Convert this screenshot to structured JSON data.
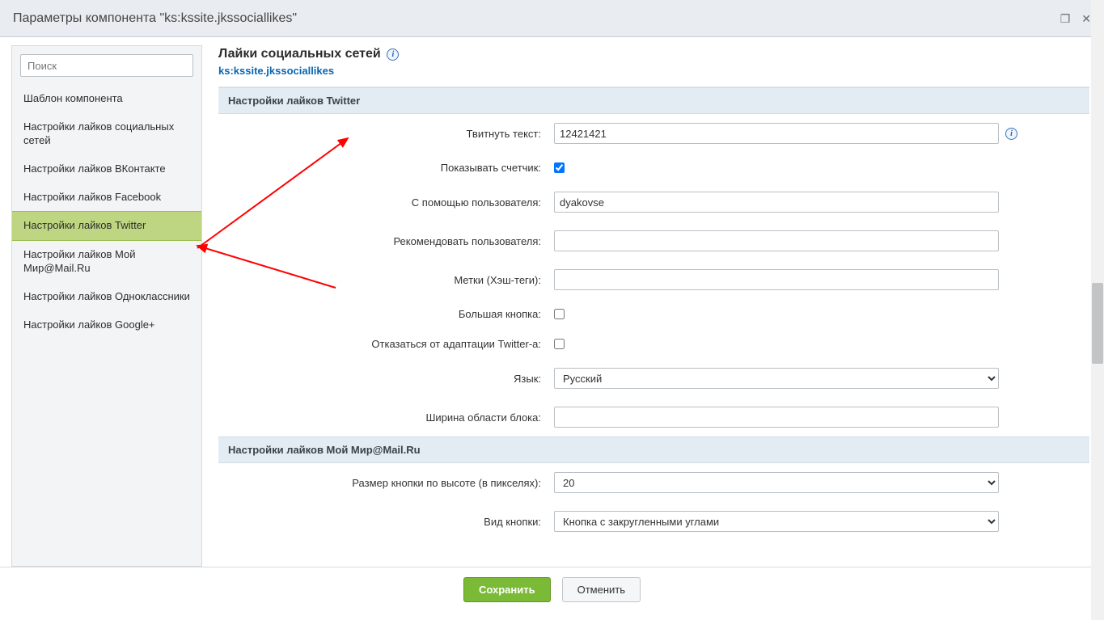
{
  "window": {
    "title": "Параметры компонента \"ks:kssite.jkssociallikes\""
  },
  "sidebar": {
    "search_placeholder": "Поиск",
    "items": [
      {
        "label": "Шаблон компонента"
      },
      {
        "label": "Настройки лайков социальных сетей"
      },
      {
        "label": "Настройки лайков ВКонтакте"
      },
      {
        "label": "Настройки лайков Facebook"
      },
      {
        "label": "Настройки лайков Twitter"
      },
      {
        "label": "Настройки лайков Мой Мир@Mail.Ru"
      },
      {
        "label": "Настройки лайков Одноклассники"
      },
      {
        "label": "Настройки лайков Google+"
      }
    ],
    "active_index": 4
  },
  "header": {
    "title": "Лайки социальных сетей",
    "component": "ks:kssite.jkssociallikes"
  },
  "sections": {
    "twitter": {
      "title": "Настройки лайков Twitter",
      "fields": {
        "tweet_text_label": "Твитнуть текст:",
        "tweet_text_value": "12421421",
        "show_counter_label": "Показывать счетчик:",
        "show_counter_checked": true,
        "via_user_label": "С помощью пользователя:",
        "via_user_value": "dyakovse",
        "recommend_user_label": "Рекомендовать пользователя:",
        "recommend_user_value": "",
        "hashtags_label": "Метки (Хэш-теги):",
        "hashtags_value": "",
        "big_button_label": "Большая кнопка:",
        "big_button_checked": false,
        "dnt_label": "Отказаться от адаптации Twitter-а:",
        "dnt_checked": false,
        "lang_label": "Язык:",
        "lang_value": "Русский",
        "width_label": "Ширина области блока:",
        "width_value": ""
      }
    },
    "mailru": {
      "title": "Настройки лайков Мой Мир@Mail.Ru",
      "fields": {
        "height_label": "Размер кнопки по высоте (в пикселях):",
        "height_value": "20",
        "button_kind_label": "Вид кнопки:",
        "button_kind_value": "Кнопка с закругленными углами"
      }
    }
  },
  "footer": {
    "save": "Сохранить",
    "cancel": "Отменить"
  }
}
